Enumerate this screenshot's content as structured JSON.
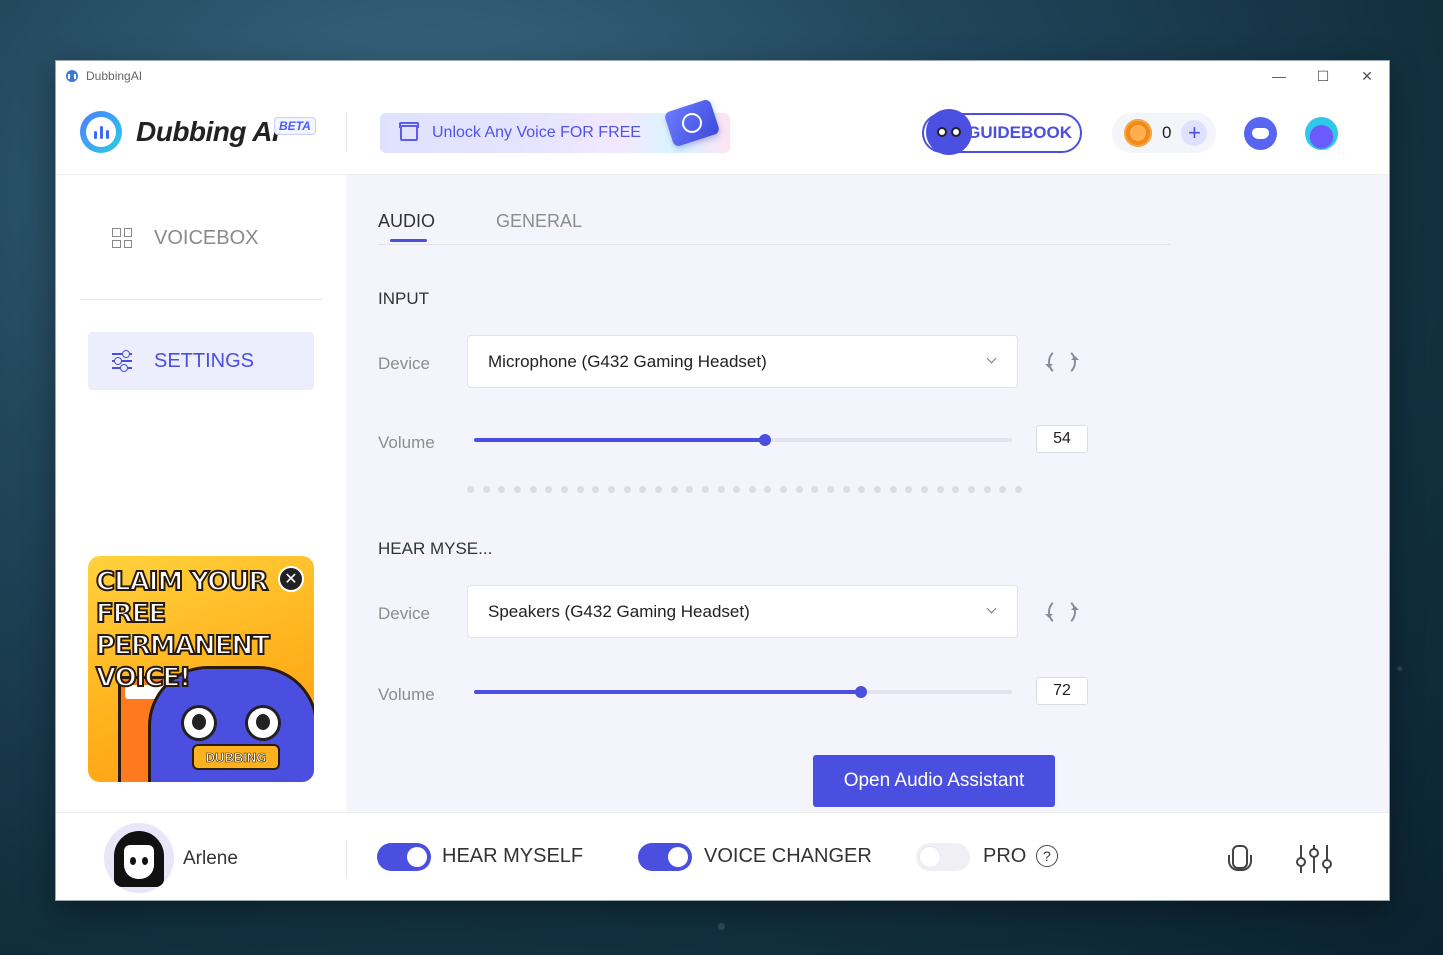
{
  "window": {
    "title": "DubbingAI",
    "controls": {
      "minimize": "—",
      "maximize": "☐",
      "close": "✕"
    }
  },
  "header": {
    "logo_text": "Dubbing AI",
    "beta_badge": "BETA",
    "promo_text": "Unlock Any Voice FOR FREE",
    "guidebook_label": "GUIDEBOOK",
    "coin_count": "0",
    "add_coins": "+"
  },
  "sidebar": {
    "items": [
      {
        "label": "VOICEBOX",
        "icon": "grid-icon"
      },
      {
        "label": "SETTINGS",
        "icon": "sliders-icon"
      }
    ],
    "banner": {
      "text": "CLAIM YOUR\nFREE PERMANENT\nVOICE!",
      "close": "✕",
      "tag": "DUBBING"
    }
  },
  "main": {
    "tabs": [
      {
        "label": "AUDIO",
        "active": true
      },
      {
        "label": "GENERAL",
        "active": false
      }
    ],
    "input": {
      "section_title": "INPUT",
      "device_label": "Device",
      "device_value": "Microphone (G432 Gaming Headset)",
      "volume_label": "Volume",
      "volume": 54
    },
    "hear_myself": {
      "section_title": "HEAR MYSE...",
      "device_label": "Device",
      "device_value": "Speakers (G432 Gaming Headset)",
      "volume_label": "Volume",
      "volume": 72
    },
    "assistant_button": "Open Audio Assistant"
  },
  "footer": {
    "user_name": "Arlene",
    "toggles": [
      {
        "label": "HEAR MYSELF",
        "on": true
      },
      {
        "label": "VOICE CHANGER",
        "on": true
      },
      {
        "label": "PRO",
        "on": false
      }
    ],
    "help": "?"
  },
  "colors": {
    "accent": "#4b4fe0",
    "active_bg": "#eceefe",
    "main_bg": "#f4f5fc"
  }
}
